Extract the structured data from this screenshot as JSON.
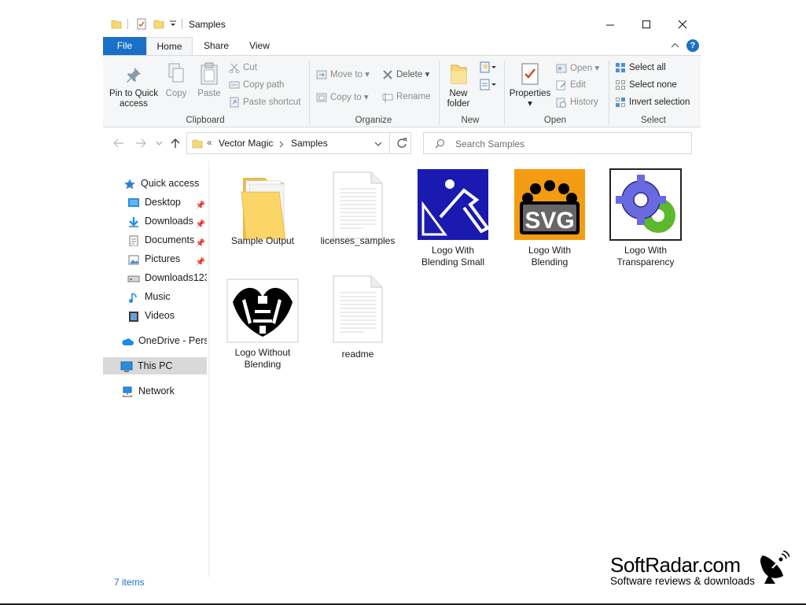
{
  "window": {
    "title": "Samples"
  },
  "ribbon_tabs": [
    "File",
    "Home",
    "Share",
    "View"
  ],
  "clipboard": {
    "pin_label_1": "Pin to Quick",
    "pin_label_2": "access",
    "copy": "Copy",
    "paste": "Paste",
    "cut": "Cut",
    "copy_path": "Copy path",
    "paste_shortcut": "Paste shortcut",
    "group": "Clipboard"
  },
  "organize": {
    "move_to": "Move to",
    "copy_to": "Copy to",
    "delete": "Delete",
    "rename": "Rename",
    "group": "Organize"
  },
  "new": {
    "new_folder_1": "New",
    "new_folder_2": "folder",
    "group": "New"
  },
  "open": {
    "properties": "Properties",
    "open": "Open",
    "edit": "Edit",
    "history": "History",
    "group": "Open"
  },
  "select": {
    "select_all": "Select all",
    "select_none": "Select none",
    "invert": "Invert selection",
    "group": "Select"
  },
  "address": {
    "prefix": "«",
    "crumb1": "Vector Magic",
    "crumb2": "Samples",
    "search_placeholder": "Search Samples"
  },
  "nav": {
    "quick_access": "Quick access",
    "desktop": "Desktop",
    "downloads": "Downloads",
    "documents": "Documents",
    "pictures": "Pictures",
    "downloads123": "Downloads123",
    "music": "Music",
    "videos": "Videos",
    "onedrive": "OneDrive - Perso",
    "this_pc": "This PC",
    "network": "Network"
  },
  "files": [
    {
      "line1": "Sample Output",
      "line2": ""
    },
    {
      "line1": "licenses_samples",
      "line2": ""
    },
    {
      "line1": "Logo With",
      "line2": "Blending Small"
    },
    {
      "line1": "Logo With",
      "line2": "Blending"
    },
    {
      "line1": "Logo With",
      "line2": "Transparency"
    },
    {
      "line1": "Logo Without",
      "line2": "Blending"
    },
    {
      "line1": "readme",
      "line2": ""
    }
  ],
  "status": {
    "items": "7 items"
  },
  "watermark": {
    "title": "SoftRadar.com",
    "subtitle": "Software reviews & downloads"
  }
}
